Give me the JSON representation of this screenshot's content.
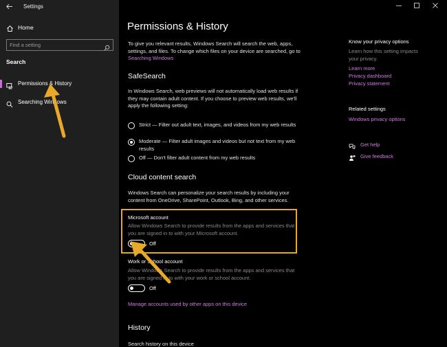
{
  "window": {
    "title": "Settings"
  },
  "sidebar": {
    "home_label": "Home",
    "search_placeholder": "Find a setting",
    "section_label": "Search",
    "items": [
      {
        "label": "Permissions & History",
        "icon": "permissions-icon",
        "active": true
      },
      {
        "label": "Searching Windows",
        "icon": "search-icon",
        "active": false
      }
    ]
  },
  "main": {
    "title": "Permissions & History",
    "intro_text": "To give you relevant results, Windows Search will search the web, apps, settings, and files. To change which files on your device are searched, go to ",
    "intro_link": "Searching Windows",
    "safesearch": {
      "heading": "SafeSearch",
      "desc": "In Windows Search, web previews will not automatically load web results if they may contain adult content. If you choose to preview web results, we'll apply the following setting:",
      "options": [
        {
          "label": "Strict — Filter out adult text, images, and videos from my web results",
          "checked": false
        },
        {
          "label": "Moderate — Filter adult images and videos but not text from my web results",
          "checked": true
        },
        {
          "label": "Off — Don't filter adult content from my web results",
          "checked": false
        }
      ]
    },
    "cloud": {
      "heading": "Cloud content search",
      "desc": "Windows Search can personalize your search results by including your content from OneDrive, SharePoint, Outlook, Bing, and other services.",
      "microsoft": {
        "title": "Microsoft account",
        "desc": "Allow Windows Search to provide results from the apps and services that you are signed in to with your Microsoft account.",
        "toggle_label": "Off",
        "toggle_on": false
      },
      "work": {
        "title": "Work or School account",
        "desc": "Allow Windows Search to provide results from the apps and services that you are signed in to with your work or school account.",
        "toggle_label": "Off",
        "toggle_on": false
      },
      "manage_link": "Manage accounts used by other apps on this device"
    },
    "history": {
      "heading": "History",
      "sub": "Search history on this device"
    }
  },
  "right": {
    "privacy_heading": "Know your privacy options",
    "privacy_desc": "Learn how this setting impacts your privacy.",
    "privacy_links": [
      "Learn more",
      "Privacy dashboard",
      "Privacy statement"
    ],
    "related_heading": "Related settings",
    "related_link": "Windows privacy options",
    "help_label": "Get help",
    "feedback_label": "Give feedback"
  },
  "colors": {
    "accent": "#c56fd6",
    "link": "#d17ce3",
    "highlight": "#e9a82a",
    "sidebar_bg": "#1f1f1f",
    "main_bg": "#000000"
  }
}
